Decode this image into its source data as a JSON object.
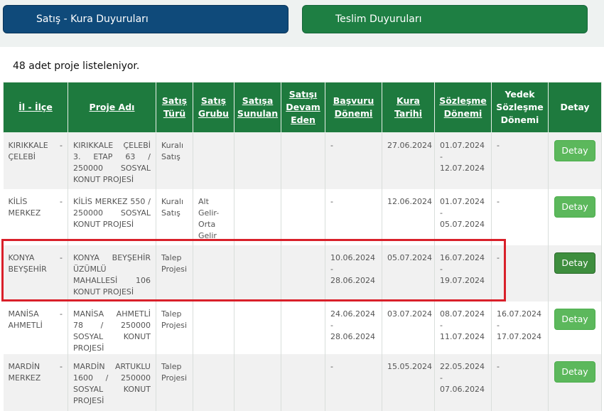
{
  "tabs": {
    "sales_label": "Satış - Kura Duyuruları",
    "delivery_label": "Teslim Duyuruları"
  },
  "count_text": "48 adet proje listeleniyor.",
  "table": {
    "headers": {
      "il_ilce": "İl - İlçe",
      "proje_adi": "Proje Adı",
      "satis_turu": "Satış Türü",
      "satis_grubu": "Satış Grubu",
      "satisa_sunulan": "Satışa Sunulan",
      "satisi_devam_eden": "Satışı Devam Eden",
      "basvuru_donemi": "Başvuru Dönemi",
      "kura_tarihi": "Kura Tarihi",
      "sozlesme_donemi": "Sözleşme Dönemi",
      "yedek_sozlesme_donemi": "Yedek Sözleşme Dönemi",
      "detay": "Detay"
    },
    "rows": [
      {
        "il": "KIRIKKALE",
        "ilce": "ÇELEBİ",
        "proje": "KIRIKKALE ÇELEBİ 3. ETAP 63 / 250000 SOSYAL KONUT PROJESİ",
        "tur": "Kuralı Satış",
        "grup": "",
        "sunulan": "",
        "devam": "",
        "basvuru": "-",
        "kura": "27.06.2024",
        "sozlesme": "01.07.2024 - 12.07.2024",
        "yedek": "-",
        "detay": "Detay"
      },
      {
        "il": "KİLİS",
        "ilce": "MERKEZ",
        "proje": "KİLİS MERKEZ 550 / 250000 SOSYAL KONUT PROJESİ",
        "tur": "Kuralı Satış",
        "grup": "Alt Gelir-Orta Gelir",
        "sunulan": "",
        "devam": "",
        "basvuru": "-",
        "kura": "12.06.2024",
        "sozlesme": "01.07.2024 - 05.07.2024",
        "yedek": "-",
        "detay": "Detay"
      },
      {
        "il": "KONYA",
        "ilce": "BEYŞEHİR",
        "proje": "KONYA BEYŞEHİR ÜZÜMLÜ MAHALLESİ 106 KONUT PROJESİ",
        "tur": "Talep Projesi",
        "grup": "",
        "sunulan": "",
        "devam": "",
        "basvuru": "10.06.2024 - 28.06.2024",
        "kura": "05.07.2024",
        "sozlesme": "16.07.2024 - 19.07.2024",
        "yedek": "-",
        "detay": "Detay"
      },
      {
        "il": "MANİSA",
        "ilce": "AHMETLİ",
        "proje": "MANİSA AHMETLİ 78 / 250000 SOSYAL KONUT PROJESİ",
        "tur": "Talep Projesi",
        "grup": "",
        "sunulan": "",
        "devam": "",
        "basvuru": "24.06.2024 - 28.06.2024",
        "kura": "03.07.2024",
        "sozlesme": "08.07.2024 - 11.07.2024",
        "yedek": "16.07.2024 - 17.07.2024",
        "detay": "Detay"
      },
      {
        "il": "MARDİN",
        "ilce": "MERKEZ",
        "proje": "MARDİN ARTUKLU 1600 / 250000 SOSYAL KONUT PROJESİ",
        "tur": "Talep Projesi",
        "grup": "",
        "sunulan": "",
        "devam": "",
        "basvuru": "-",
        "kura": "15.05.2024",
        "sozlesme": "22.05.2024 - 07.06.2024",
        "yedek": "-",
        "detay": "Detay"
      }
    ]
  },
  "colors": {
    "sales_tab": "#0f4a7a",
    "delivery_tab": "#1e7f43",
    "header_bg": "#1e7a3e",
    "detay_button": "#5cb85c",
    "highlight": "#d9202a"
  }
}
